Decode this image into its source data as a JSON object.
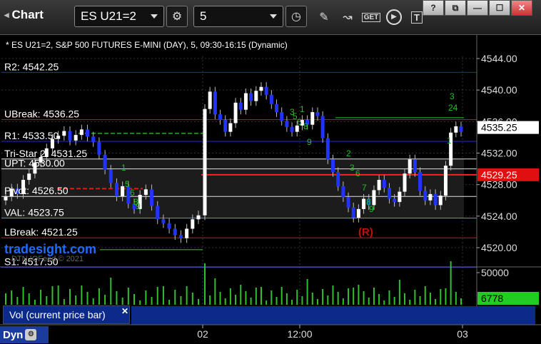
{
  "toolbar": {
    "app_title": "Chart",
    "symbol": "ES U21=2",
    "interval": "5"
  },
  "window_buttons": [
    "?",
    "⧉",
    "—",
    "☐",
    "✕"
  ],
  "chart": {
    "header": "* ES U21=2, S&P 500 FUTURES E-MINI (DAY), 5, 09:30-16:15 (Dynamic)",
    "watermark": "tradesight.com",
    "watermark_sub": "DTN IQFeed © 2021",
    "price_axis": [
      "4544.00",
      "4540.00",
      "4536.00",
      "4532.00",
      "4528.00",
      "4524.00",
      "4520.00"
    ],
    "last_price": "4535.25",
    "level_price": "4529.25",
    "time_axis": [
      "02",
      "12:00",
      "03"
    ],
    "levels": [
      {
        "label": "R2: 4542.25",
        "price": 4542.25,
        "color": "#1e2bd6"
      },
      {
        "label": "UBreak: 4536.25",
        "price": 4536.25,
        "color": "#d01818"
      },
      {
        "label": "R1: 4533.50",
        "price": 4533.5,
        "color": "#1e2bd6"
      },
      {
        "label": "Tri-Star 2: 4531.25",
        "price": 4531.25,
        "color": "#e0e0e0"
      },
      {
        "label": "UPT: 4530.00",
        "price": 4530.0,
        "color": "#e0e0e0"
      },
      {
        "label": "Pivot: 4526.50",
        "price": 4526.5,
        "color": "#e0e0e0"
      },
      {
        "label": "VAL: 4523.75",
        "price": 4523.75,
        "color": "#20c0c0"
      },
      {
        "label": "LBreak: 4521.25",
        "price": 4521.25,
        "color": "#d01818"
      },
      {
        "label": "S1: 4517.50",
        "price": 4517.5,
        "color": "#1e2bd6"
      }
    ],
    "signal_marker": "(R)"
  },
  "volume": {
    "axis_label": "50000",
    "current_value": "6778",
    "panel_label": "Vol (current price bar)"
  },
  "bottom": {
    "mode": "Dyn"
  }
}
